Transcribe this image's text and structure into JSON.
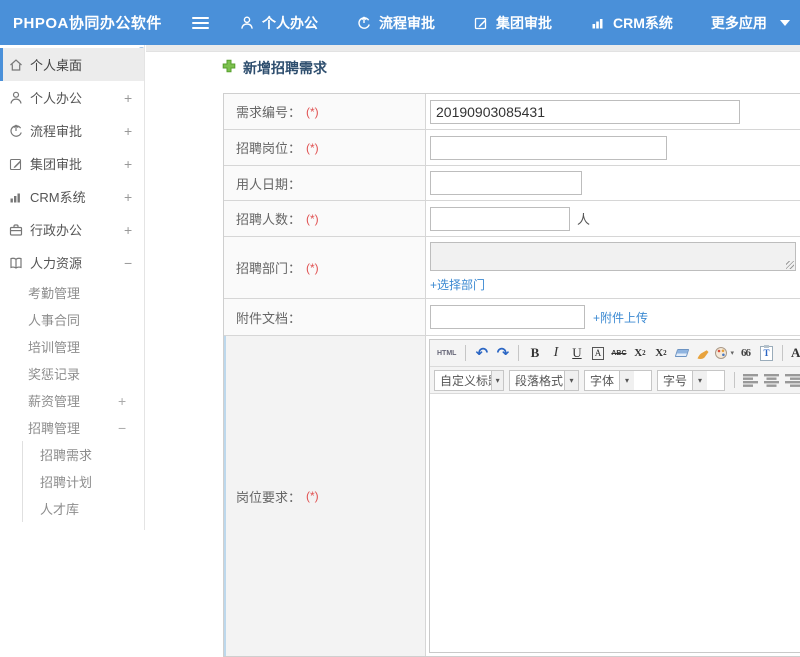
{
  "colors": {
    "topbar_blue": "#4a90d9",
    "link_blue": "#3c8ad2",
    "required_red": "#e05252",
    "title_navy": "#2e4e6e",
    "accent_green": "#7cc14e"
  },
  "topbar": {
    "brand": "PHPOA协同办公软件",
    "nav": [
      {
        "label": "个人办公"
      },
      {
        "label": "流程审批"
      },
      {
        "label": "集团审批"
      },
      {
        "label": "CRM系统"
      },
      {
        "label": "更多应用"
      }
    ]
  },
  "sidebar": {
    "items": [
      {
        "label": "个人桌面"
      },
      {
        "label": "个人办公",
        "expand": "+"
      },
      {
        "label": "流程审批",
        "expand": "+"
      },
      {
        "label": "集团审批",
        "expand": "+"
      },
      {
        "label": "CRM系统",
        "expand": "+"
      },
      {
        "label": "行政办公",
        "expand": "+"
      },
      {
        "label": "人力资源",
        "expand": "−"
      },
      {
        "label": "考勤管理"
      },
      {
        "label": "人事合同"
      },
      {
        "label": "培训管理"
      },
      {
        "label": "奖惩记录"
      },
      {
        "label": "薪资管理",
        "expand": "+"
      },
      {
        "label": "招聘管理",
        "expand": "−"
      },
      {
        "label": "招聘需求"
      },
      {
        "label": "招聘计划"
      },
      {
        "label": "人才库"
      }
    ]
  },
  "main": {
    "title": "新增招聘需求",
    "form": {
      "rows": [
        {
          "label": "需求编号：",
          "req": "(*)",
          "value": "20190903085431"
        },
        {
          "label": "招聘岗位：",
          "req": "(*)",
          "value": ""
        },
        {
          "label": "用人日期：",
          "req": "",
          "value": ""
        },
        {
          "label": "招聘人数：",
          "req": "(*)",
          "value": "",
          "suffix": "人"
        },
        {
          "label": "招聘部门：",
          "req": "(*)",
          "link": "+选择部门"
        },
        {
          "label": "附件文档：",
          "req": "",
          "value": "",
          "link": "+附件上传"
        },
        {
          "label": "岗位要求：",
          "req": "(*)"
        }
      ]
    }
  },
  "editor": {
    "html_label": "HTML",
    "undo_glyph": "↶",
    "redo_glyph": "↷",
    "bold": "B",
    "italic": "I",
    "underline": "U",
    "box_a": "A",
    "strike": "ABC",
    "sup_base": "X",
    "sup_exp": "2",
    "sub_base": "X",
    "sub_exp": "2",
    "quote": "66",
    "paste_letter": "T",
    "font_color": "A",
    "highlight": "a",
    "selects": [
      {
        "label": "自定义标题"
      },
      {
        "label": "段落格式"
      },
      {
        "label": "字体"
      },
      {
        "label": "字号"
      }
    ]
  }
}
